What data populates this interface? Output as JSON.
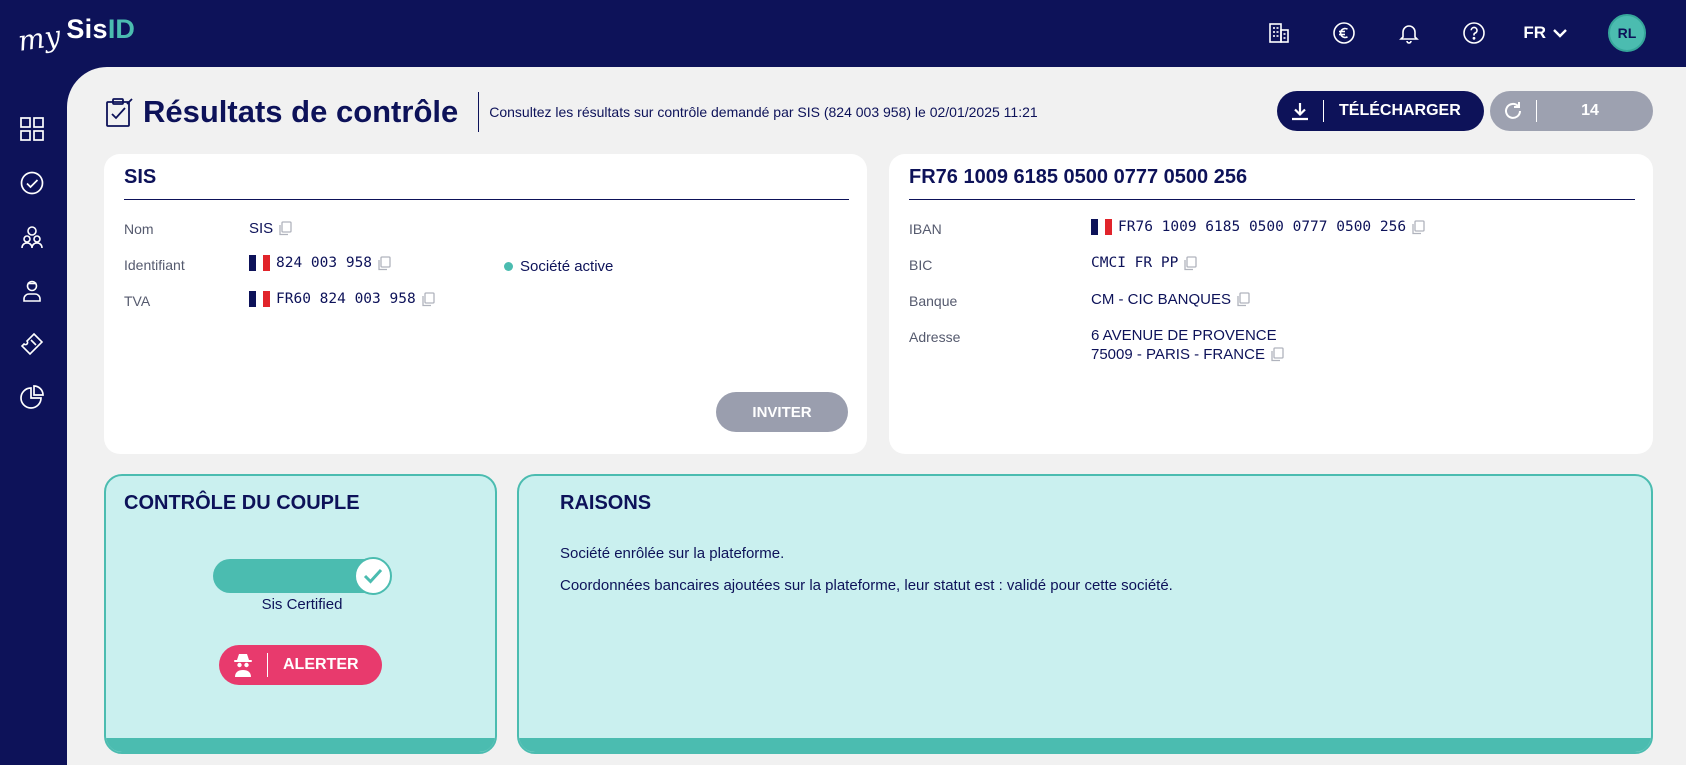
{
  "topbar": {
    "logo_my": "my",
    "logo_sis": "Sis",
    "logo_id": "ID",
    "icons": [
      "building-icon",
      "euro-icon",
      "bell-icon",
      "help-icon"
    ],
    "lang": "FR",
    "avatar": "RL"
  },
  "sidebar": {
    "items": [
      "dashboard-icon",
      "check-circle-icon",
      "users-icon",
      "user-icon",
      "ticket-icon",
      "pie-chart-icon"
    ]
  },
  "header": {
    "title": "Résultats de contrôle",
    "subtitle": "Consultez les résultats sur contrôle demandé par  SIS  (824 003 958)  le 02/01/2025 11:21",
    "download_label": "TÉLÉCHARGER",
    "refresh_count": "14"
  },
  "company": {
    "title": "SIS",
    "name_label": "Nom",
    "name_value": "SIS",
    "id_label": "Identifiant",
    "id_value": "824 003 958",
    "status": "Société active",
    "vat_label": "TVA",
    "vat_value": "FR60 824 003 958",
    "invite_label": "INVITER"
  },
  "bank": {
    "title": "FR76 1009 6185 0500 0777 0500 256",
    "iban_label": "IBAN",
    "iban_value": "FR76 1009 6185 0500 0777 0500 256",
    "bic_label": "BIC",
    "bic_value": "CMCI FR PP",
    "bank_label": "Banque",
    "bank_value": "CM - CIC BANQUES",
    "address_label": "Adresse",
    "address_line1": "6 AVENUE DE PROVENCE",
    "address_line2": "75009 - PARIS - FRANCE"
  },
  "couple": {
    "title": "CONTRÔLE DU COUPLE",
    "toggle_label": "Sis Certified",
    "alert_label": "ALERTER"
  },
  "reasons": {
    "title": "RAISONS",
    "items": [
      "Société enrôlée sur la plateforme.",
      "Coordonnées bancaires ajoutées sur la plateforme, leur statut est : validé pour cette société."
    ]
  },
  "colors": {
    "navy": "#0d1259",
    "teal": "#4bbcb0",
    "teal_light": "#caf0ef",
    "pink": "#e83a6d",
    "grey_button": "#9a9eae"
  }
}
